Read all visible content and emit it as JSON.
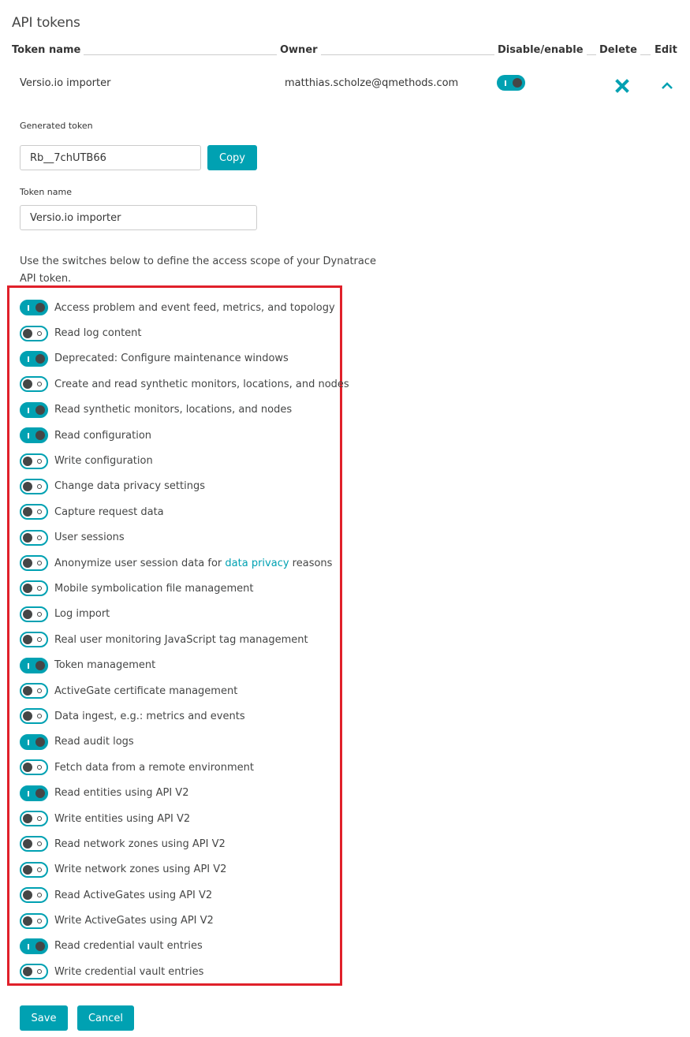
{
  "page": {
    "title": "API tokens"
  },
  "table": {
    "headers": {
      "token_name": "Token name",
      "owner": "Owner",
      "disable_enable": "Disable/enable",
      "delete": "Delete",
      "edit": "Edit"
    },
    "row": {
      "token_name": "Versio.io importer",
      "owner": "matthias.scholze@qmethods.com",
      "enabled": true,
      "delete_icon": "close-x-icon",
      "edit_icon": "chevron-up-icon"
    }
  },
  "edit_form": {
    "generated_token_label": "Generated token",
    "generated_token_value": "Rb__7chUTB66",
    "copy_label": "Copy",
    "token_name_label": "Token name",
    "token_name_value": "Versio.io importer",
    "scope_intro": "Use the switches below to define the access scope of your Dynatrace API token."
  },
  "scopes": [
    {
      "label": "Access problem and event feed, metrics, and topology",
      "enabled": true
    },
    {
      "label": "Read log content",
      "enabled": false
    },
    {
      "label": "Deprecated: Configure maintenance windows",
      "enabled": true
    },
    {
      "label": "Create and read synthetic monitors, locations, and nodes",
      "enabled": false
    },
    {
      "label": "Read synthetic monitors, locations, and nodes",
      "enabled": true
    },
    {
      "label": "Read configuration",
      "enabled": true
    },
    {
      "label": "Write configuration",
      "enabled": false
    },
    {
      "label": "Change data privacy settings",
      "enabled": false
    },
    {
      "label": "Capture request data",
      "enabled": false
    },
    {
      "label": "User sessions",
      "enabled": false
    },
    {
      "label": "Anonymize user session data for ",
      "link": "data privacy",
      "suffix": " reasons",
      "enabled": false
    },
    {
      "label": "Mobile symbolication file management",
      "enabled": false
    },
    {
      "label": "Log import",
      "enabled": false
    },
    {
      "label": "Real user monitoring JavaScript tag management",
      "enabled": false
    },
    {
      "label": "Token management",
      "enabled": true
    },
    {
      "label": "ActiveGate certificate management",
      "enabled": false
    },
    {
      "label": "Data ingest, e.g.: metrics and events",
      "enabled": false
    },
    {
      "label": "Read audit logs",
      "enabled": true
    },
    {
      "label": "Fetch data from a remote environment",
      "enabled": false
    },
    {
      "label": "Read entities using API V2",
      "enabled": true
    },
    {
      "label": "Write entities using API V2",
      "enabled": false
    },
    {
      "label": "Read network zones using API V2",
      "enabled": false
    },
    {
      "label": "Write network zones using API V2",
      "enabled": false
    },
    {
      "label": "Read ActiveGates using API V2",
      "enabled": false
    },
    {
      "label": "Write ActiveGates using API V2",
      "enabled": false
    },
    {
      "label": "Read credential vault entries",
      "enabled": true
    },
    {
      "label": "Write credential vault entries",
      "enabled": false
    }
  ],
  "actions": {
    "save_label": "Save",
    "cancel_label": "Cancel"
  },
  "colors": {
    "accent": "#00a1b2",
    "highlight_border": "#e0202a",
    "text": "#454646"
  }
}
